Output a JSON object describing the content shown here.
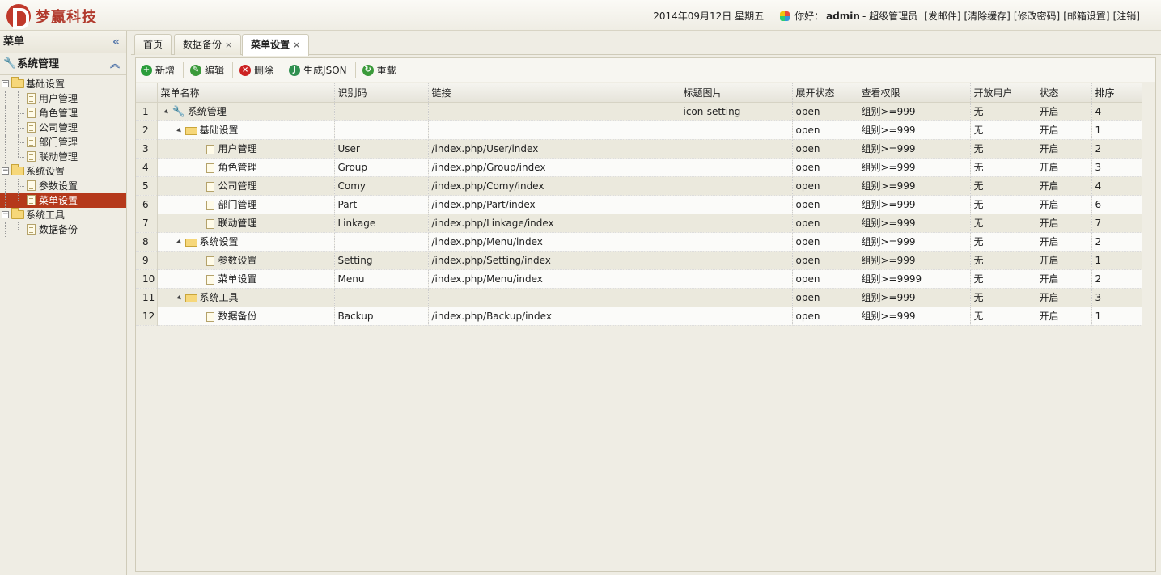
{
  "header": {
    "logo_text": "梦赢科技",
    "date": "2014年09月12日 星期五",
    "greeting": "你好：",
    "username": "admin",
    "role": "- 超级管理员",
    "links": [
      "[发邮件]",
      "[清除缓存]",
      "[修改密码]",
      "[邮箱设置]",
      "[注销]"
    ]
  },
  "sidebar": {
    "title": "菜单",
    "section": "系统管理",
    "tree": [
      {
        "label": "基础设置",
        "type": "folder",
        "level": 0
      },
      {
        "label": "用户管理",
        "type": "doc",
        "level": 1
      },
      {
        "label": "角色管理",
        "type": "doc",
        "level": 1
      },
      {
        "label": "公司管理",
        "type": "doc",
        "level": 1
      },
      {
        "label": "部门管理",
        "type": "doc",
        "level": 1
      },
      {
        "label": "联动管理",
        "type": "doc",
        "level": 1
      },
      {
        "label": "系统设置",
        "type": "folder",
        "level": 0
      },
      {
        "label": "参数设置",
        "type": "doc",
        "level": 1
      },
      {
        "label": "菜单设置",
        "type": "doc",
        "level": 1,
        "selected": true
      },
      {
        "label": "系统工具",
        "type": "folder",
        "level": 0
      },
      {
        "label": "数据备份",
        "type": "doc",
        "level": 1
      }
    ]
  },
  "tabs": [
    {
      "label": "首页",
      "closable": false
    },
    {
      "label": "数据备份",
      "closable": true
    },
    {
      "label": "菜单设置",
      "closable": true,
      "active": true
    }
  ],
  "toolbar": {
    "add": "新增",
    "edit": "编辑",
    "delete": "删除",
    "json": "生成JSON",
    "reload": "重载"
  },
  "grid": {
    "columns": [
      "菜单名称",
      "识别码",
      "链接",
      "标题图片",
      "展开状态",
      "查看权限",
      "开放用户",
      "状态",
      "排序"
    ],
    "rows": [
      {
        "n": "1",
        "name": "系统管理",
        "icon": "wrench",
        "depth": 0,
        "code": "",
        "link": "",
        "img": "icon-setting",
        "open": "open",
        "perm": "组别>=999",
        "user": "无",
        "status": "开启",
        "sort": "4"
      },
      {
        "n": "2",
        "name": "基础设置",
        "icon": "folder",
        "depth": 1,
        "code": "",
        "link": "",
        "img": "",
        "open": "open",
        "perm": "组别>=999",
        "user": "无",
        "status": "开启",
        "sort": "1"
      },
      {
        "n": "3",
        "name": "用户管理",
        "icon": "doc",
        "depth": 2,
        "code": "User",
        "link": "/index.php/User/index",
        "img": "",
        "open": "open",
        "perm": "组别>=999",
        "user": "无",
        "status": "开启",
        "sort": "2"
      },
      {
        "n": "4",
        "name": "角色管理",
        "icon": "doc",
        "depth": 2,
        "code": "Group",
        "link": "/index.php/Group/index",
        "img": "",
        "open": "open",
        "perm": "组别>=999",
        "user": "无",
        "status": "开启",
        "sort": "3"
      },
      {
        "n": "5",
        "name": "公司管理",
        "icon": "doc",
        "depth": 2,
        "code": "Comy",
        "link": "/index.php/Comy/index",
        "img": "",
        "open": "open",
        "perm": "组别>=999",
        "user": "无",
        "status": "开启",
        "sort": "4"
      },
      {
        "n": "6",
        "name": "部门管理",
        "icon": "doc",
        "depth": 2,
        "code": "Part",
        "link": "/index.php/Part/index",
        "img": "",
        "open": "open",
        "perm": "组别>=999",
        "user": "无",
        "status": "开启",
        "sort": "6"
      },
      {
        "n": "7",
        "name": "联动管理",
        "icon": "doc",
        "depth": 2,
        "code": "Linkage",
        "link": "/index.php/Linkage/index",
        "img": "",
        "open": "open",
        "perm": "组别>=999",
        "user": "无",
        "status": "开启",
        "sort": "7"
      },
      {
        "n": "8",
        "name": "系统设置",
        "icon": "folder",
        "depth": 1,
        "code": "",
        "link": "/index.php/Menu/index",
        "img": "",
        "open": "open",
        "perm": "组别>=999",
        "user": "无",
        "status": "开启",
        "sort": "2"
      },
      {
        "n": "9",
        "name": "参数设置",
        "icon": "doc",
        "depth": 2,
        "code": "Setting",
        "link": "/index.php/Setting/index",
        "img": "",
        "open": "open",
        "perm": "组别>=999",
        "user": "无",
        "status": "开启",
        "sort": "1"
      },
      {
        "n": "10",
        "name": "菜单设置",
        "icon": "doc",
        "depth": 2,
        "code": "Menu",
        "link": "/index.php/Menu/index",
        "img": "",
        "open": "open",
        "perm": "组别>=9999",
        "user": "无",
        "status": "开启",
        "sort": "2"
      },
      {
        "n": "11",
        "name": "系统工具",
        "icon": "folder",
        "depth": 1,
        "code": "",
        "link": "",
        "img": "",
        "open": "open",
        "perm": "组别>=999",
        "user": "无",
        "status": "开启",
        "sort": "3"
      },
      {
        "n": "12",
        "name": "数据备份",
        "icon": "doc",
        "depth": 2,
        "code": "Backup",
        "link": "/index.php/Backup/index",
        "img": "",
        "open": "open",
        "perm": "组别>=999",
        "user": "无",
        "status": "开启",
        "sort": "1"
      }
    ]
  },
  "colors": {
    "accent": "#b5391b",
    "background": "#efede4",
    "add": "#2a9d3a",
    "edit": "#3a9a3a",
    "delete": "#cc2222",
    "json": "#2f8f4f",
    "reload": "#3a9a3a"
  }
}
